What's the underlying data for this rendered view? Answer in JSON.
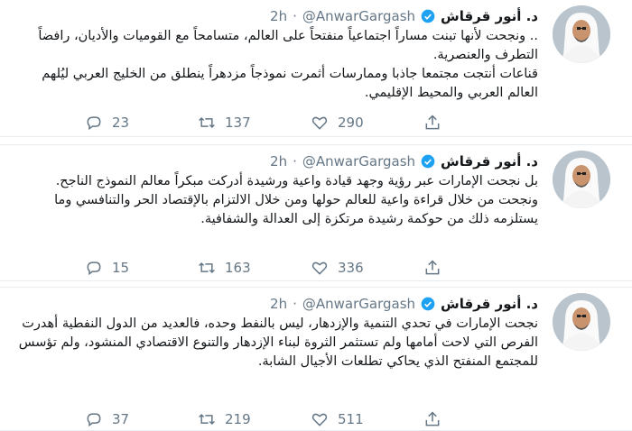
{
  "tweets": [
    {
      "name": "د. أنور قرقاش",
      "handle": "@AnwarGargash",
      "dot": "·",
      "time": "2h",
      "lines": [
        ".. ونجحت لأنها تبنت مساراً اجتماعياً منفتحاً على العالم، متسامحاً مع القوميات والأديان، رافضاً التطرف والعنصرية.",
        "قناعات أنتجت مجتمعا جاذبا وممارسات أثمرت نموذجاً مزدهراً ينطلق من الخليج العربي ليُلهم العالم العربي والمحيط الإقليمي."
      ],
      "replies": "23",
      "retweets": "137",
      "likes": "290"
    },
    {
      "name": "د. أنور قرقاش",
      "handle": "@AnwarGargash",
      "dot": "·",
      "time": "2h",
      "lines": [
        "بل نجحت الإمارات عبر رؤية وجهد قيادة واعية ورشيدة أدركت مبكراً معالم النموذج الناجح. ونجحت من خلال قراءة واعية للعالم حولها ومن خلال الالتزام بالإقتصاد الحر والتنافسي وما يستلزمه ذلك من حوكمة رشيدة مرتكزة إلى العدالة والشفافية."
      ],
      "replies": "15",
      "retweets": "163",
      "likes": "336"
    },
    {
      "name": "د. أنور قرقاش",
      "handle": "@AnwarGargash",
      "dot": "·",
      "time": "2h",
      "lines": [
        "نجحت الإمارات في تحدي التنمية والإزدهار، ليس بالنفط وحده، فالعديد من الدول النفطية أهدرت الفرص التي لاحت أمامها ولم تستثمر  الثروة لبناء الإزدهار والتنوع الاقتصادي المنشود، ولم تؤسس للمجتمع المنفتح الذي يحاكي تطلعات الأجيال الشابة."
      ],
      "replies": "37",
      "retweets": "219",
      "likes": "511"
    }
  ],
  "icons": [
    "reply-icon",
    "retweet-icon",
    "like-icon",
    "share-icon",
    "verified-badge-icon"
  ],
  "colors": {
    "verified": "#1da1f2",
    "muted": "#657786",
    "divider": "#e6ecf0",
    "text": "#14171a"
  }
}
